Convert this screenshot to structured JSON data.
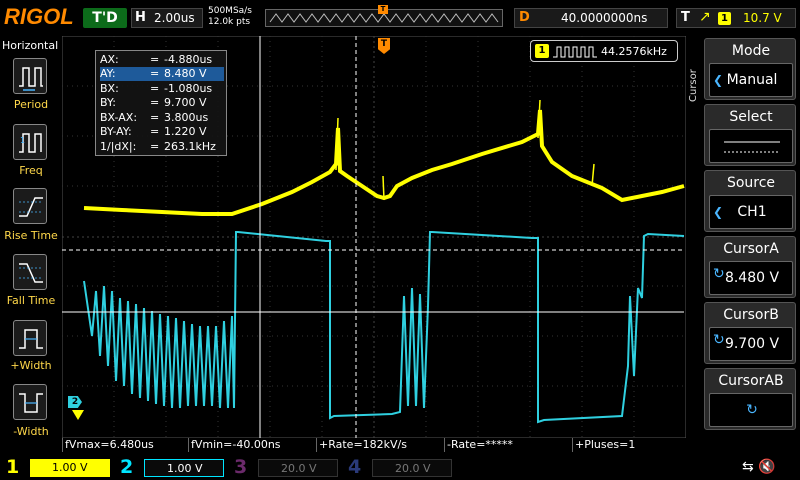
{
  "top": {
    "brand": "RIGOL",
    "trigger_status": "T'D",
    "timebase_tag": "H",
    "timebase": "2.00us",
    "sample_rate": "500MSa/s",
    "memory_depth": "12.0k pts",
    "trig_pos_marker": "T",
    "delay_tag": "D",
    "delay": "40.0000000ns",
    "trigger_tag": "T",
    "trigger_source": "1",
    "trigger_level": "10.7 V"
  },
  "left_panel": {
    "title": "Horizontal",
    "items": [
      {
        "label": "Period",
        "icon": "period-icon"
      },
      {
        "label": "Freq",
        "icon": "freq-icon"
      },
      {
        "label": "Rise Time",
        "icon": "rise-time-icon"
      },
      {
        "label": "Fall Time",
        "icon": "fall-time-icon"
      },
      {
        "label": "+Width",
        "icon": "positive-width-icon"
      },
      {
        "label": "-Width",
        "icon": "negative-width-icon"
      }
    ]
  },
  "cursor_readout": {
    "rows": [
      {
        "k": "AX:",
        "v": "-4.880us"
      },
      {
        "k": "AY:",
        "v": "8.480 V"
      },
      {
        "k": "BX:",
        "v": "-1.080us"
      },
      {
        "k": "BY:",
        "v": "9.700 V"
      },
      {
        "k": "BX-AX:",
        "v": "3.800us"
      },
      {
        "k": "BY-AY:",
        "v": "1.220 V"
      },
      {
        "k": "1/|dX|:",
        "v": "263.1kHz"
      }
    ],
    "eq": "="
  },
  "freq_counter": {
    "channel": "1",
    "value": "44.2576kHz"
  },
  "markers": {
    "ch2": "2",
    "trigger_level": "T"
  },
  "right_menu": {
    "section": "Cursor",
    "mode_label": "Mode",
    "mode_value": "Manual",
    "select_label": "Select",
    "source_label": "Source",
    "source_value": "CH1",
    "cursor_a_label": "CursorA",
    "cursor_a_value": "8.480 V",
    "cursor_b_label": "CursorB",
    "cursor_b_value": "9.700 V",
    "cursor_ab_label": "CursorAB"
  },
  "measurements": [
    "fVmax=6.480us",
    "fVmin=-40.00ns",
    "+Rate=182kV/s",
    "-Rate=*****",
    "+Pluses=1"
  ],
  "channels": [
    {
      "num": "1",
      "scale": "1.00 V",
      "color": "#ffff00"
    },
    {
      "num": "2",
      "scale": "1.00 V",
      "color": "#00e5ff"
    },
    {
      "num": "3",
      "scale": "20.0 V",
      "color": "#cc44cc"
    },
    {
      "num": "4",
      "scale": "20.0 V",
      "color": "#3b6cff"
    }
  ],
  "colors": {
    "ch1": "#ffff00",
    "ch2": "#2fd0e0",
    "accent": "#ff8a00"
  }
}
